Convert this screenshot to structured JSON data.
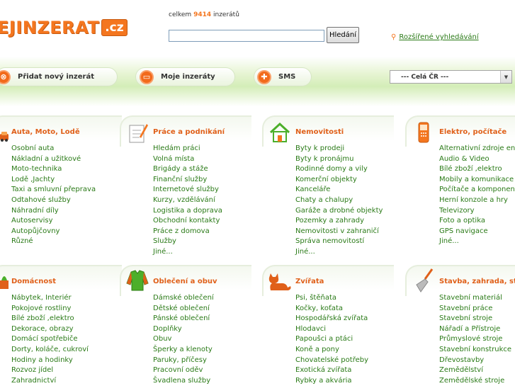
{
  "header": {
    "logo_main": "EJINZERAT",
    "logo_suffix": ".cz",
    "counter_prefix": "celkem",
    "counter_value": "9414",
    "counter_suffix": "inzerátů",
    "search_value": "",
    "search_button": "Hledání",
    "advanced_search": "Rozšířené vyhledávání"
  },
  "nav": {
    "add_ad": "Přidat nový inzerát",
    "my_ads": "Moje inzeráty",
    "sms": "SMS",
    "region": "--- Celá ČR ---"
  },
  "colors": {
    "accent": "#f4761f",
    "link": "#2a7a17",
    "band": "#d4edb8"
  },
  "categories": [
    {
      "title": "Auta, Moto, Lodě",
      "icon": "car-icon",
      "items": [
        "Osobní auta",
        "Nákladní a užitkové",
        "Moto-technika",
        "Lodě ,Jachty",
        "Taxi a smluvní přeprava",
        "Odtahové služby",
        "Náhradní díly",
        "Autoservisy",
        "Autopůjčovny",
        "Různé"
      ]
    },
    {
      "title": "Práce a podnikání",
      "icon": "notepad-icon",
      "items": [
        "Hledám práci",
        "Volná místa",
        "Brigády a stáže",
        "Finanční služby",
        "Internetové služby",
        "Kurzy, vzdělávání",
        "Logistika a doprava",
        "Obchodní kontakty",
        "Práce z domova",
        "Služby",
        "Jiné..."
      ]
    },
    {
      "title": "Nemovitosti",
      "icon": "house-icon",
      "items": [
        "Byty k prodeji",
        "Byty k pronájmu",
        "Rodinné domy a vily",
        "Komerční objekty",
        "Kanceláře",
        "Chaty a chalupy",
        "Garáže a drobné objekty",
        "Pozemky a zahrady",
        "Nemovitosti v zahraničí",
        "Správa nemovitostí",
        "Jiné..."
      ]
    },
    {
      "title": "Elektro, počítače",
      "icon": "phone-icon",
      "items": [
        "Alternativní zdroje energie",
        "Audio & Video",
        "Bílé zboží ,elektro",
        "Mobily a komunikace",
        "Počítače a komponenty",
        "Herní konzole a hry",
        "Televizory",
        "Foto a optika",
        "GPS navigace",
        "Jiné..."
      ]
    },
    {
      "title": "Domácnost",
      "icon": "household-icon",
      "items": [
        "Nábytek, Interiér",
        "Pokojové rostliny",
        "Bílé zboží ,elektro",
        "Dekorace, obrazy",
        "Domácí spotřebiče",
        "Dorty, koláče, cukroví",
        "Hodiny a hodinky",
        "Rozvoz jídel",
        "Zahradnictví"
      ]
    },
    {
      "title": "Oblečení a obuv",
      "icon": "jacket-icon",
      "items": [
        "Dámské oblečení",
        "Dětské oblečení",
        "Pánské oblečení",
        "Doplňky",
        "Obuv",
        "Šperky a klenoty",
        "Paruky, příčesy",
        "Pracovní oděv",
        "Švadlena služby"
      ]
    },
    {
      "title": "Zvířata",
      "icon": "cat-icon",
      "items": [
        "Psi, štěňata",
        "Kočky, koťata",
        "Hospodářská zvířata",
        "Hlodavci",
        "Papoušci a ptáci",
        "Koně a pony",
        "Chovatelské potřeby",
        "Exotická zvířata",
        "Rybky a akvária"
      ]
    },
    {
      "title": "Stavba, zahrada, stroje",
      "icon": "trowel-icon",
      "items": [
        "Stavební materiál",
        "Stavební práce",
        "Stavební stroje",
        "Nářadí a Přístroje",
        "Průmyslové stroje",
        "Stavební konstrukce",
        "Dřevostavby",
        "Zemědělství",
        "Zemědělské stroje"
      ]
    }
  ]
}
